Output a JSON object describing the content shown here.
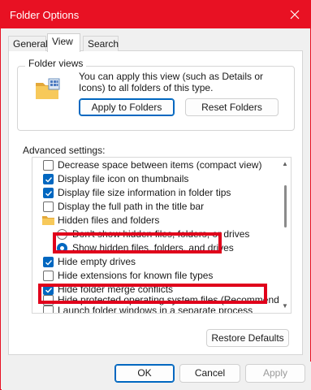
{
  "window": {
    "title": "Folder Options"
  },
  "tabs": [
    {
      "label": "General"
    },
    {
      "label": "View"
    },
    {
      "label": "Search"
    }
  ],
  "folder_views": {
    "legend": "Folder views",
    "description": "You can apply this view (such as Details or Icons) to all folders of this type.",
    "apply_button": "Apply to Folders",
    "reset_button": "Reset Folders"
  },
  "advanced": {
    "label": "Advanced settings:",
    "items": [
      {
        "type": "checkbox",
        "checked": false,
        "label": "Decrease space between items (compact view)"
      },
      {
        "type": "checkbox",
        "checked": true,
        "label": "Display file icon on thumbnails"
      },
      {
        "type": "checkbox",
        "checked": true,
        "label": "Display file size information in folder tips"
      },
      {
        "type": "checkbox",
        "checked": false,
        "label": "Display the full path in the title bar"
      },
      {
        "type": "folder",
        "label": "Hidden files and folders"
      },
      {
        "type": "radio",
        "checked": false,
        "label": "Don't show hidden files, folders, or drives"
      },
      {
        "type": "radio",
        "checked": true,
        "label": "Show hidden files, folders, and drives"
      },
      {
        "type": "checkbox",
        "checked": true,
        "label": "Hide empty drives"
      },
      {
        "type": "checkbox",
        "checked": false,
        "label": "Hide extensions for known file types"
      },
      {
        "type": "checkbox",
        "checked": true,
        "label": "Hide folder merge conflicts"
      },
      {
        "type": "checkbox",
        "checked": false,
        "label": "Hide protected operating system files (Recommended)"
      },
      {
        "type": "checkbox",
        "checked": false,
        "label": "Launch folder windows in a separate process"
      }
    ]
  },
  "restore_button": "Restore Defaults",
  "footer": {
    "ok": "OK",
    "cancel": "Cancel",
    "apply": "Apply"
  },
  "colors": {
    "accent": "#0067c0",
    "titlebar": "#e81123",
    "highlight": "#e0001b"
  }
}
